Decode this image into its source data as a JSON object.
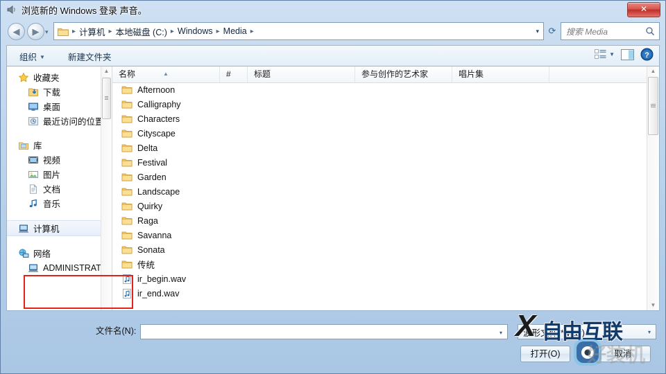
{
  "window": {
    "title": "浏览新的 Windows 登录 声音。",
    "title_icon": "speaker-icon",
    "close_label": "✕"
  },
  "address": {
    "back_icon": "◀",
    "forward_icon": "▶",
    "dropdown_icon": "▾",
    "folder_icon": "folder-icon",
    "breadcrumbs": [
      "计算机",
      "本地磁盘 (C:)",
      "Windows",
      "Media"
    ],
    "separator": "▸",
    "caret": "▾",
    "refresh_icon": "⟳"
  },
  "search": {
    "placeholder": "搜索 Media",
    "icon": "search-icon"
  },
  "toolbar": {
    "organize_label": "组织",
    "organize_caret": "▼",
    "new_folder_label": "新建文件夹",
    "view_icon": "list-view-icon",
    "view_caret": "▼",
    "preview_pane_icon": "preview-pane-icon",
    "help_icon": "help-icon"
  },
  "sidebar": {
    "groups": [
      {
        "header": {
          "label": "收藏夹",
          "icon": "star-icon"
        },
        "items": [
          {
            "label": "下载",
            "icon": "downloads-icon"
          },
          {
            "label": "桌面",
            "icon": "desktop-icon"
          },
          {
            "label": "最近访问的位置",
            "icon": "recent-places-icon"
          }
        ]
      },
      {
        "header": {
          "label": "库",
          "icon": "library-icon"
        },
        "items": [
          {
            "label": "视频",
            "icon": "video-icon"
          },
          {
            "label": "图片",
            "icon": "pictures-icon"
          },
          {
            "label": "文档",
            "icon": "documents-icon"
          },
          {
            "label": "音乐",
            "icon": "music-icon"
          }
        ]
      },
      {
        "header": {
          "label": "计算机",
          "icon": "computer-icon"
        },
        "items": []
      },
      {
        "header": {
          "label": "网络",
          "icon": "network-icon"
        },
        "items": [
          {
            "label": "ADMINISTRATO",
            "icon": "computer-icon",
            "expand": "▾"
          }
        ]
      }
    ]
  },
  "filelist": {
    "columns": [
      {
        "label": "名称",
        "sorted": "asc",
        "sort_mark": "▲"
      },
      {
        "label": "#"
      },
      {
        "label": "标题"
      },
      {
        "label": "参与创作的艺术家"
      },
      {
        "label": "唱片集"
      }
    ],
    "rows": [
      {
        "name": "Afternoon",
        "type": "folder"
      },
      {
        "name": "Calligraphy",
        "type": "folder"
      },
      {
        "name": "Characters",
        "type": "folder"
      },
      {
        "name": "Cityscape",
        "type": "folder"
      },
      {
        "name": "Delta",
        "type": "folder"
      },
      {
        "name": "Festival",
        "type": "folder"
      },
      {
        "name": "Garden",
        "type": "folder"
      },
      {
        "name": "Landscape",
        "type": "folder"
      },
      {
        "name": "Quirky",
        "type": "folder"
      },
      {
        "name": "Raga",
        "type": "folder"
      },
      {
        "name": "Savanna",
        "type": "folder"
      },
      {
        "name": "Sonata",
        "type": "folder"
      },
      {
        "name": "传统",
        "type": "folder"
      },
      {
        "name": "ir_begin.wav",
        "type": "audio"
      },
      {
        "name": "ir_end.wav",
        "type": "audio"
      }
    ],
    "scroll_up": "▲",
    "scroll_down": "▼"
  },
  "form": {
    "filename_label": "文件名(N):",
    "filename_value": "",
    "filename_caret": "▾",
    "filter_value": "波形文件(*.wav)",
    "filter_caret": "▾",
    "open_label": "打开(O)",
    "cancel_label": "取消"
  },
  "annotation": {
    "highlight_color": "#e2231a"
  },
  "watermarks": {
    "top_x": "X",
    "top_text": "自由互联",
    "bottom_text": "好装机"
  }
}
